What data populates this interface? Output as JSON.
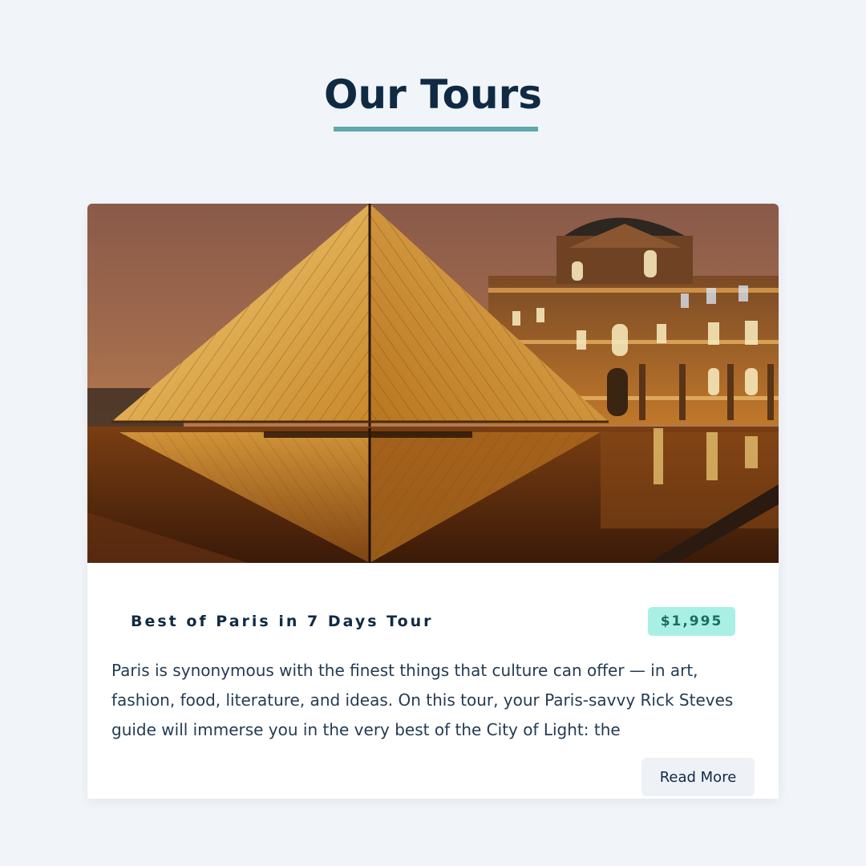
{
  "section": {
    "title": "Our Tours"
  },
  "tour": {
    "name": "Best of Paris in 7 Days Tour",
    "price": "$1,995",
    "description": "Paris is synonymous with the finest things that culture can offer — in art, fashion, food, literature, and ideas. On this tour, your Paris-savvy Rick Steves guide will immerse you in the very best of the City of Light: the",
    "read_more_label": "Read More",
    "image_alt": "Louvre pyramid at night"
  },
  "colors": {
    "background": "#f1f4f8",
    "title": "#102a43",
    "accent_underline": "#5fa8ab",
    "price_badge_bg": "#a8f0e4",
    "price_badge_text": "#1e6b62",
    "button_bg": "#eef2f7"
  }
}
